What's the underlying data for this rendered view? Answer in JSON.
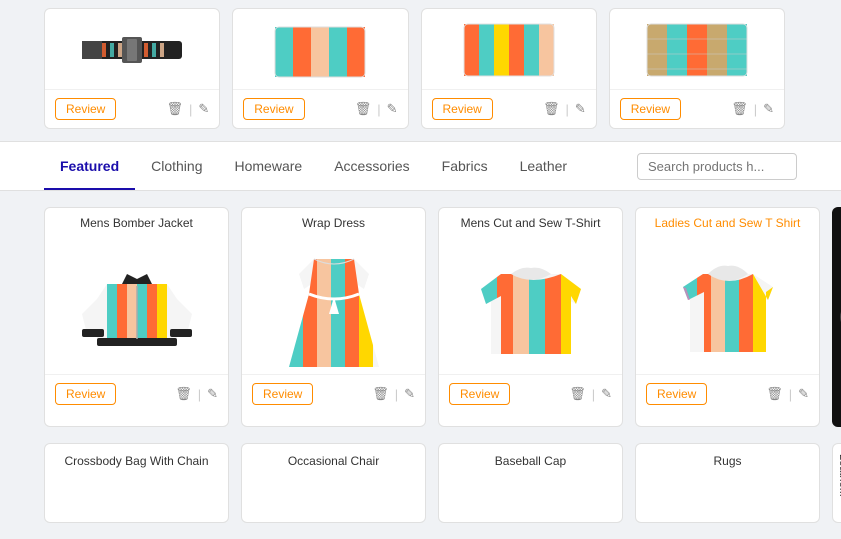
{
  "topRow": {
    "cards": [
      {
        "id": "top-1",
        "hasImage": true
      },
      {
        "id": "top-2",
        "hasImage": true
      },
      {
        "id": "top-3",
        "hasImage": true
      },
      {
        "id": "top-4",
        "hasImage": true
      }
    ],
    "reviewLabel": "Review",
    "deleteIcon": "🗑",
    "editIcon": "✎",
    "divider": "|"
  },
  "tabs": {
    "items": [
      {
        "id": "featured",
        "label": "Featured",
        "active": true
      },
      {
        "id": "clothing",
        "label": "Clothing",
        "active": false
      },
      {
        "id": "homeware",
        "label": "Homeware",
        "active": false
      },
      {
        "id": "accessories",
        "label": "Accessories",
        "active": false
      },
      {
        "id": "fabrics",
        "label": "Fabrics",
        "active": false
      },
      {
        "id": "leather",
        "label": "Leather",
        "active": false
      }
    ],
    "searchPlaceholder": "Search products h..."
  },
  "mainRow": {
    "cards": [
      {
        "id": "mens-bomber",
        "title": "Mens Bomber Jacket",
        "orange": false,
        "type": "bomber"
      },
      {
        "id": "wrap-dress",
        "title": "Wrap Dress",
        "orange": false,
        "type": "dress"
      },
      {
        "id": "mens-cut-tshirt",
        "title": "Mens Cut and Sew T-Shirt",
        "orange": false,
        "type": "tshirt"
      },
      {
        "id": "ladies-cut-tshirt",
        "title": "Ladies Cut and Sew T Shirt",
        "orange": true,
        "type": "ladies"
      }
    ],
    "reviewLabel": "Review",
    "deleteIcon": "🗑",
    "editIcon": "✎",
    "divider": "|",
    "partialText": "Le..."
  },
  "bottomRow": {
    "cards": [
      {
        "id": "crossbody-bag",
        "title": "Crossbody Bag With Chain"
      },
      {
        "id": "occasional-chair",
        "title": "Occasional Chair"
      },
      {
        "id": "baseball-cap",
        "title": "Baseball Cap"
      },
      {
        "id": "rugs",
        "title": "Rugs"
      }
    ],
    "partialTitle": "Leathe..."
  }
}
